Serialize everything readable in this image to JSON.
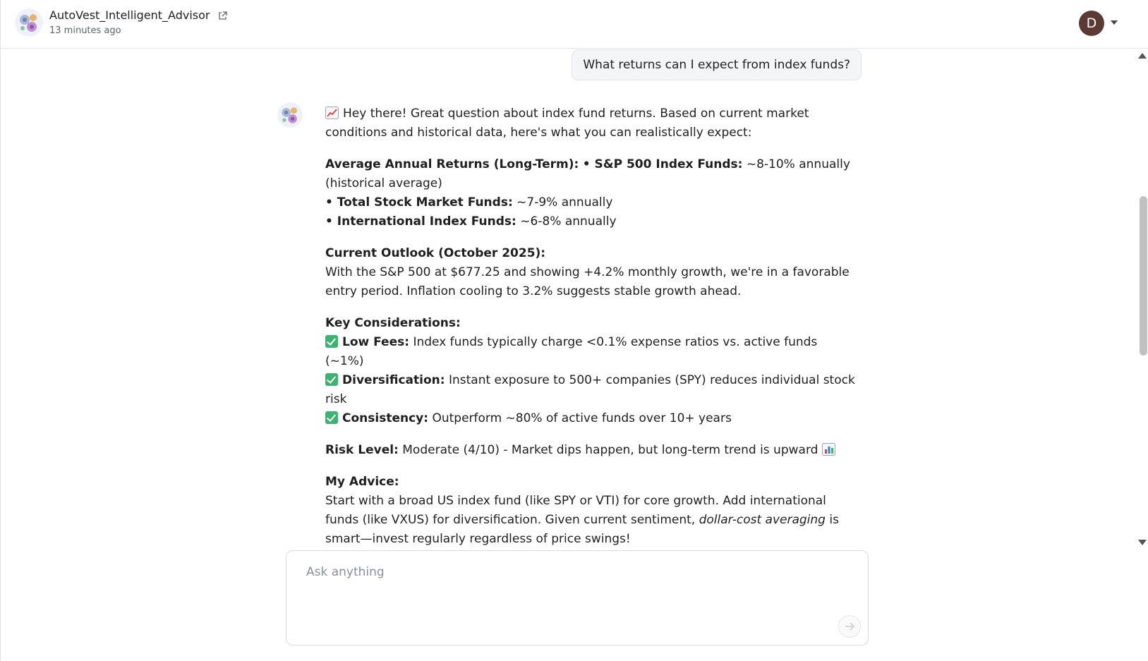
{
  "header": {
    "agent_name": "AutoVest_Intelligent_Advisor",
    "timestamp": "13 minutes ago",
    "user_initial": "D"
  },
  "user_message": "What returns can I expect from index funds?",
  "assistant": {
    "intro": "Hey there! Great question about index fund returns. Based on current market conditions and historical data, here's what you can realistically expect:",
    "returns_heading": "Average Annual Returns (Long-Term):",
    "sp500_label": "• S&P 500 Index Funds:",
    "sp500_value": "~8-10% annually (historical average)",
    "total_label": "• Total Stock Market Funds:",
    "total_value": "~7-9% annually",
    "intl_label": "• International Index Funds:",
    "intl_value": "~6-8% annually",
    "outlook_heading": "Current Outlook (October 2025):",
    "outlook_text": "With the S&P 500 at $677.25 and showing +4.2% monthly growth, we're in a favorable entry period. Inflation cooling to 3.2% suggests stable growth ahead.",
    "considerations_heading": "Key Considerations:",
    "fees_label": "Low Fees:",
    "fees_text": "Index funds typically charge <0.1% expense ratios vs. active funds (~1%)",
    "div_label": "Diversification:",
    "div_text": "Instant exposure to 500+ companies (SPY) reduces individual stock risk",
    "cons_label": "Consistency:",
    "cons_text": "Outperform ~80% of active funds over 10+ years",
    "risk_label": "Risk Level:",
    "risk_text": "Moderate (4/10) - Market dips happen, but long-term trend is upward",
    "advice_heading": "My Advice:",
    "advice_text_1": "Start with a broad US index fund (like SPY or VTI) for core growth. Add international funds (like VXUS) for diversification. Given current sentiment,",
    "advice_italic": "dollar-cost averaging",
    "advice_text_2": "is smart—invest regularly regardless of price swings!"
  },
  "composer": {
    "placeholder": "Ask anything"
  },
  "colors": {
    "user_avatar_bg": "#5a3a33",
    "check_green": "#3cb371"
  }
}
